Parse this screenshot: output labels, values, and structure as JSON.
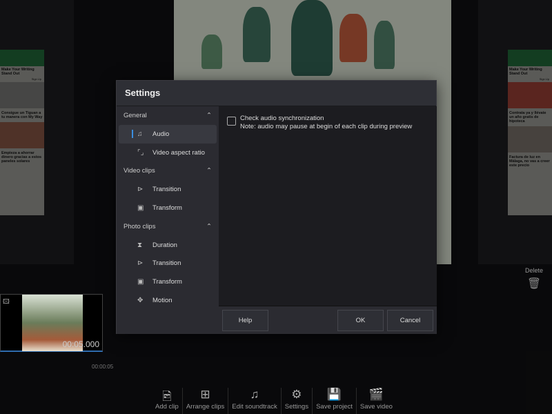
{
  "dialog": {
    "title": "Settings",
    "groups": [
      {
        "label": "General",
        "items": [
          {
            "icon": "music-note-icon",
            "label": "Audio",
            "selected": true
          },
          {
            "icon": "aspect-ratio-icon",
            "label": "Video aspect ratio"
          }
        ]
      },
      {
        "label": "Video clips",
        "items": [
          {
            "icon": "transition-icon",
            "label": "Transition"
          },
          {
            "icon": "transform-icon",
            "label": "Transform"
          }
        ]
      },
      {
        "label": "Photo clips",
        "items": [
          {
            "icon": "hourglass-icon",
            "label": "Duration"
          },
          {
            "icon": "transition-icon",
            "label": "Transition"
          },
          {
            "icon": "transform-icon",
            "label": "Transform"
          },
          {
            "icon": "motion-icon",
            "label": "Motion"
          }
        ]
      }
    ],
    "content": {
      "checkbox_label": "Check audio synchronization",
      "checkbox_checked": false,
      "note": "Note: audio may pause at begin of each clip during preview"
    },
    "buttons": {
      "help": "Help",
      "ok": "OK",
      "cancel": "Cancel"
    },
    "accent": "#3b8ee0"
  },
  "ads": {
    "left": [
      "Make Your Writing Stand Out",
      "Sign Up",
      "Consigue un Tiguan a tu manera con My Way",
      "Empieza a ahorrar dinero gracias a estos paneles solares"
    ],
    "right": [
      "Make Your Writing Stand Out",
      "Sign Up",
      "Contrata ya y llévate un año gratis de hipoteca",
      "Factura de luz en Málaga, no vas a creer este precio"
    ]
  },
  "delete": {
    "label": "Delete"
  },
  "clip": {
    "duration": "00:05.000"
  },
  "timeline": {
    "tick": "00:00:05"
  },
  "toolbar": [
    {
      "icon": "add-image-icon",
      "glyph": "🖻",
      "label": "Add clip"
    },
    {
      "icon": "grid-icon",
      "glyph": "⊞",
      "label": "Arrange clips"
    },
    {
      "icon": "music-pen-icon",
      "glyph": "♫",
      "label": "Edit soundtrack"
    },
    {
      "icon": "gear-icon",
      "glyph": "⚙",
      "label": "Settings"
    },
    {
      "icon": "floppy-icon",
      "glyph": "💾",
      "label": "Save project"
    },
    {
      "icon": "clapper-icon",
      "glyph": "🎬",
      "label": "Save video"
    }
  ]
}
